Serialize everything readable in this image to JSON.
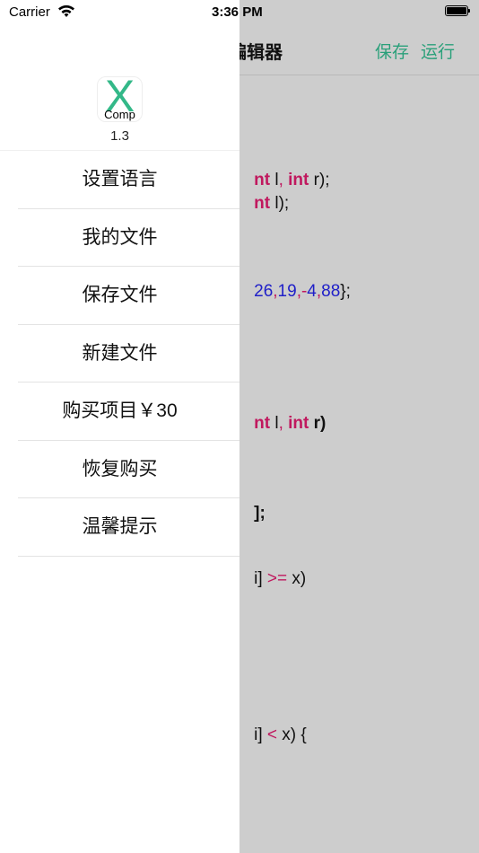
{
  "status_bar": {
    "carrier": "Carrier",
    "time": "3:36 PM"
  },
  "editor": {
    "title": "编辑器",
    "save_label": "保存",
    "run_label": "运行",
    "accent_color": "#2aa07a",
    "code_lines": [
      "nt l, int r);",
      "nt l);",
      "26,19,-4,88};",
      "nt l, int r)",
      "];",
      "i] >= x)",
      "i] < x) {"
    ]
  },
  "drawer": {
    "app_icon": {
      "letter": "X",
      "caption": "Comp"
    },
    "version": "1.3",
    "menu": [
      {
        "label": "设置语言"
      },
      {
        "label": "我的文件"
      },
      {
        "label": "保存文件"
      },
      {
        "label": "新建文件"
      },
      {
        "label": "购买项目￥30"
      },
      {
        "label": "恢复购买"
      },
      {
        "label": "温馨提示"
      }
    ]
  }
}
